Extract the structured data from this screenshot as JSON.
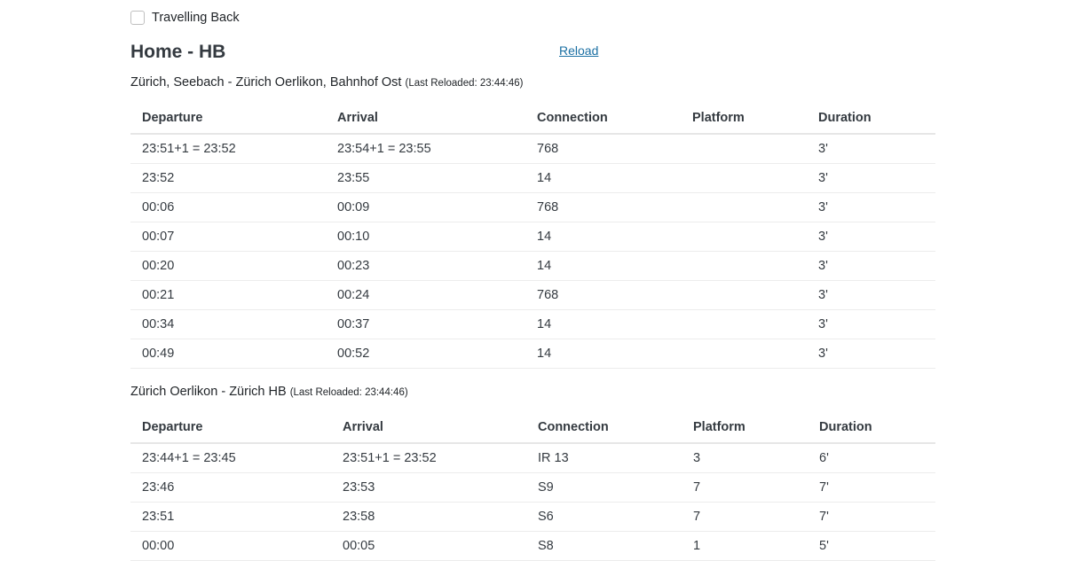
{
  "options": {
    "travelling_back_label": "Travelling Back",
    "travelling_back_checked": false
  },
  "header": {
    "title": "Home - HB",
    "reload_label": "Reload"
  },
  "sections": [
    {
      "route": "Zürich, Seebach - Zürich Oerlikon, Bahnhof Ost",
      "reloaded": "(Last Reloaded: 23:44:46)",
      "columns": [
        "Departure",
        "Arrival",
        "Connection",
        "Platform",
        "Duration"
      ],
      "rows": [
        [
          "23:51+1 = 23:52",
          "23:54+1 = 23:55",
          "768",
          "",
          "3'"
        ],
        [
          "23:52",
          "23:55",
          "14",
          "",
          "3'"
        ],
        [
          "00:06",
          "00:09",
          "768",
          "",
          "3'"
        ],
        [
          "00:07",
          "00:10",
          "14",
          "",
          "3'"
        ],
        [
          "00:20",
          "00:23",
          "14",
          "",
          "3'"
        ],
        [
          "00:21",
          "00:24",
          "768",
          "",
          "3'"
        ],
        [
          "00:34",
          "00:37",
          "14",
          "",
          "3'"
        ],
        [
          "00:49",
          "00:52",
          "14",
          "",
          "3'"
        ]
      ]
    },
    {
      "route": "Zürich Oerlikon - Zürich HB",
      "reloaded": "(Last Reloaded: 23:44:46)",
      "columns": [
        "Departure",
        "Arrival",
        "Connection",
        "Platform",
        "Duration"
      ],
      "rows": [
        [
          "23:44+1 = 23:45",
          "23:51+1 = 23:52",
          "IR 13",
          "3",
          "6'"
        ],
        [
          "23:46",
          "23:53",
          "S9",
          "7",
          "7'"
        ],
        [
          "23:51",
          "23:58",
          "S6",
          "7",
          "7'"
        ],
        [
          "00:00",
          "00:05",
          "S8",
          "1",
          "5'"
        ]
      ]
    }
  ]
}
